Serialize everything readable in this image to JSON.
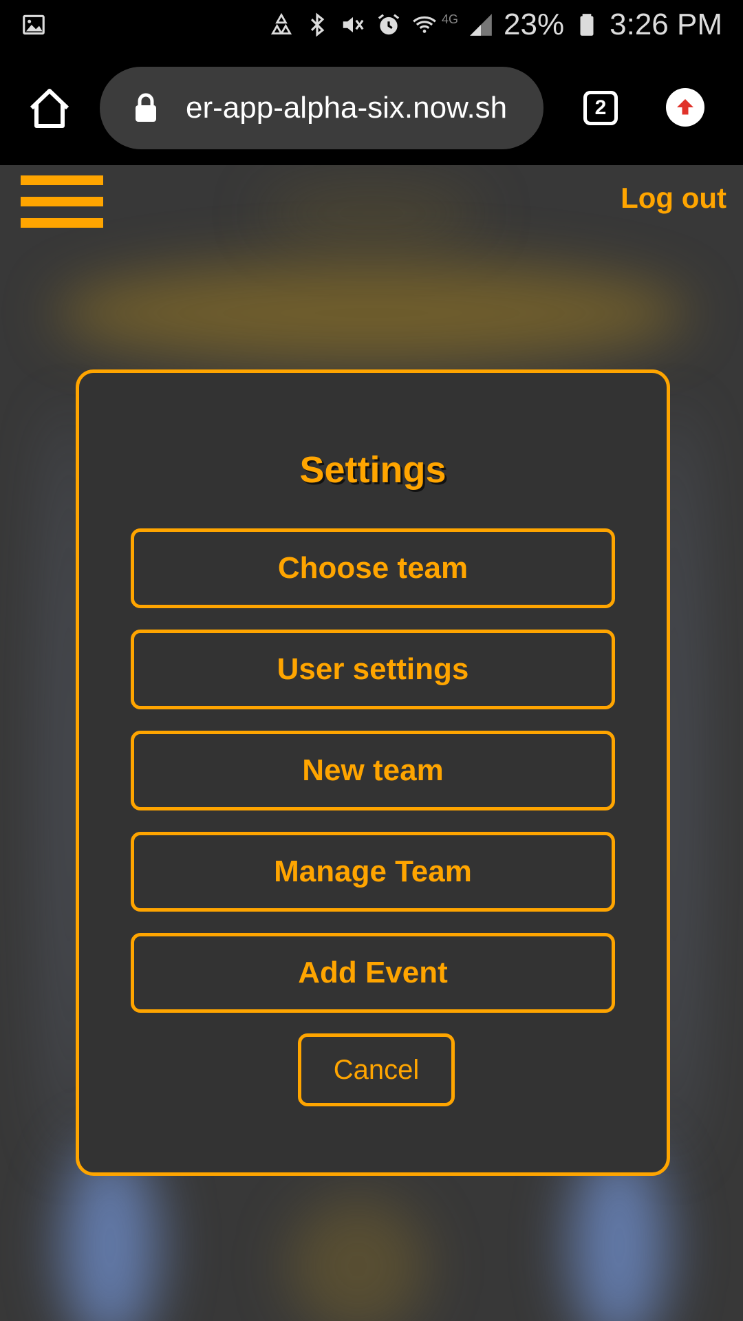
{
  "status_bar": {
    "battery_percent": "23%",
    "time": "3:26 PM",
    "network_label": "4G",
    "icons": [
      "gallery-icon",
      "recycle-icon",
      "bluetooth-icon",
      "mute-icon",
      "alarm-icon",
      "wifi-icon",
      "signal-icon",
      "battery-icon"
    ]
  },
  "browser": {
    "url": "er-app-alpha-six.now.sh",
    "tab_count": "2"
  },
  "header": {
    "logout_label": "Log out"
  },
  "modal": {
    "title": "Settings",
    "options": [
      "Choose team",
      "User settings",
      "New team",
      "Manage Team",
      "Add Event"
    ],
    "cancel_label": "Cancel"
  },
  "colors": {
    "accent": "#ffa500",
    "panel": "#333333",
    "background": "#383838"
  }
}
